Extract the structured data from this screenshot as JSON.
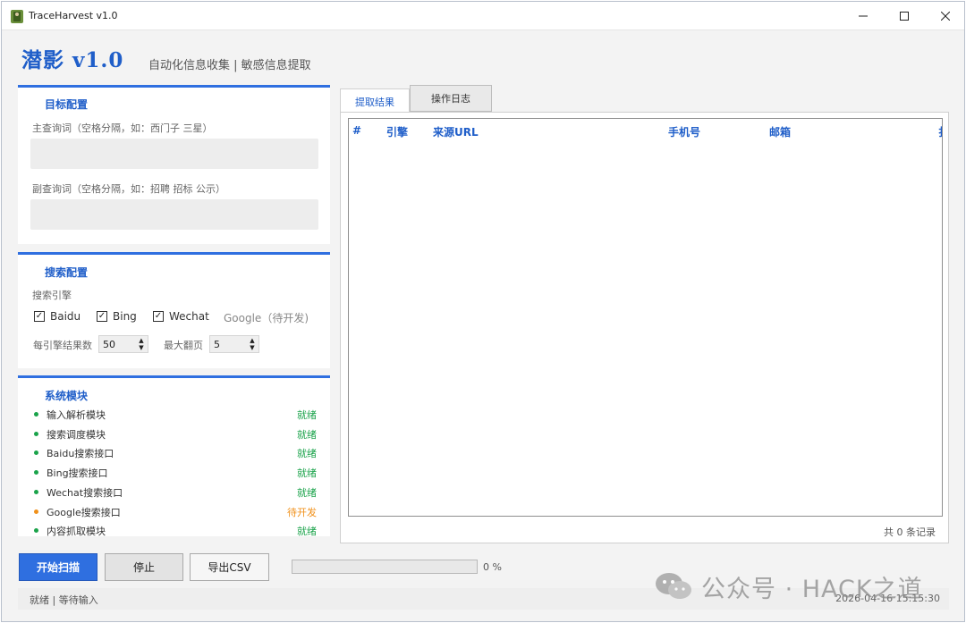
{
  "window": {
    "title": "TraceHarvest v1.0"
  },
  "header": {
    "title": "潜影  v1.0",
    "subtitle": "自动化信息收集 | 敏感信息提取"
  },
  "target_config": {
    "title": "目标配置",
    "main_query_label": "主查询词（空格分隔，如：西门子 三星）",
    "main_query_value": "",
    "sub_query_label": "副查询词（空格分隔，如：招聘 招标 公示）",
    "sub_query_value": ""
  },
  "search_config": {
    "title": "搜索配置",
    "engines_label": "搜索引擎",
    "engines": [
      {
        "label": "Baidu",
        "checked": true
      },
      {
        "label": "Bing",
        "checked": true
      },
      {
        "label": "Wechat",
        "checked": true
      }
    ],
    "google_label": "Google（待开发)",
    "results_per_engine_label": "每引擎结果数",
    "results_per_engine_value": "50",
    "max_pages_label": "最大翻页",
    "max_pages_value": "5"
  },
  "modules": {
    "title": "系统模块",
    "items": [
      {
        "name": "输入解析模块",
        "status": "就绪",
        "state": "ready"
      },
      {
        "name": "搜索调度模块",
        "status": "就绪",
        "state": "ready"
      },
      {
        "name": "Baidu搜索接口",
        "status": "就绪",
        "state": "ready"
      },
      {
        "name": "Bing搜索接口",
        "status": "就绪",
        "state": "ready"
      },
      {
        "name": "Wechat搜索接口",
        "status": "就绪",
        "state": "ready"
      },
      {
        "name": "Google搜索接口",
        "status": "待开发",
        "state": "pending"
      },
      {
        "name": "内容抓取模块",
        "status": "就绪",
        "state": "ready"
      }
    ],
    "colors": {
      "ready": "#1aa34a",
      "pending": "#f0901a"
    }
  },
  "tabs": {
    "results": "提取结果",
    "log": "操作日志"
  },
  "table": {
    "columns": [
      "#",
      "引擎",
      "来源URL",
      "手机号",
      "邮箱",
      "扌"
    ],
    "rows": [],
    "record_count": "共 0 条记录"
  },
  "actions": {
    "start": "开始扫描",
    "stop": "停止",
    "export": "导出CSV"
  },
  "progress": {
    "value": 0,
    "text": "0 %"
  },
  "status": {
    "text": "就绪 | 等待输入",
    "timestamp": "2026-04-16 15:15:30"
  },
  "watermark": {
    "text": "公众号 · HACK之道"
  },
  "theme": {
    "accent": "#2f6fe0",
    "accent_text": "#1f5ec9"
  }
}
